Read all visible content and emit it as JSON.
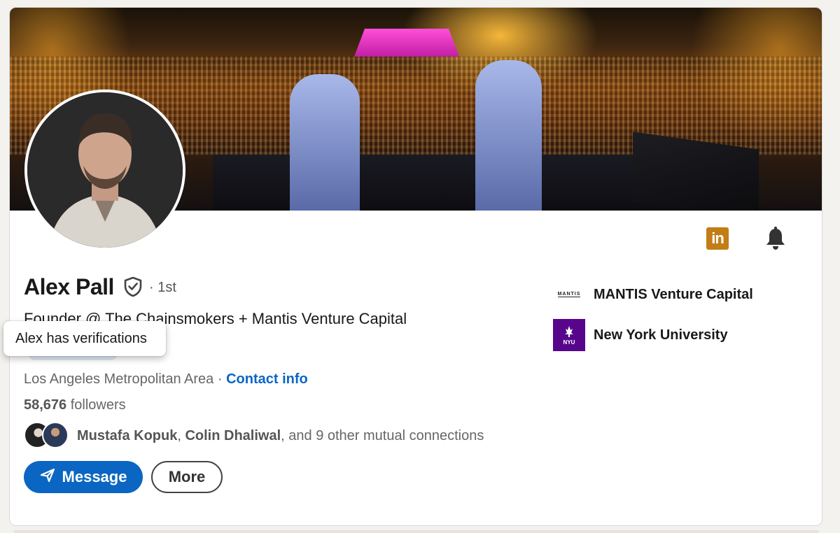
{
  "profile": {
    "name": "Alex Pall",
    "degree": "· 1st",
    "headline": "Founder @ The Chainsmokers + Mantis Venture Capital",
    "location": "Los Angeles Metropolitan Area",
    "location_separator": " · ",
    "contact_info": "Contact info",
    "followers_count": "58,676",
    "followers_label": " followers",
    "mutual_names_1": "Mustafa Kopuk",
    "mutual_sep": ", ",
    "mutual_names_2": "Colin Dhaliwal",
    "mutual_rest": ", and 9 other mutual connections"
  },
  "tooltip": {
    "text": "Alex has verifications"
  },
  "actions": {
    "message_label": "Message",
    "more_label": "More"
  },
  "organizations": [
    {
      "name": "MANTIS Venture Capital",
      "logo_text": "MANTIS",
      "icon": "mantis-logo"
    },
    {
      "name": "New York University",
      "logo_text": "NYU",
      "icon": "nyu-logo"
    }
  ],
  "icons": {
    "linkedin": "linkedin-icon",
    "bell": "bell-icon",
    "verified": "verified-shield-icon",
    "send": "send-icon"
  },
  "colors": {
    "accent": "#0a66c2",
    "linkedin_badge": "#c37d16",
    "nyu": "#57068c"
  }
}
